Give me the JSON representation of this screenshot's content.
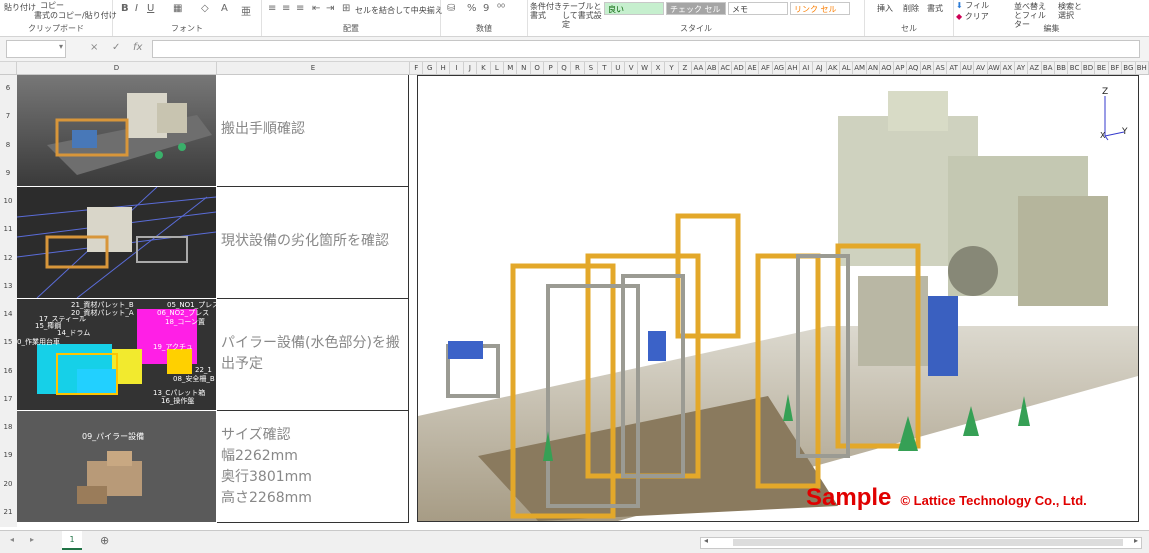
{
  "ribbon": {
    "clipboard": {
      "paste_label": "貼り付け",
      "copy_label": "コピー",
      "format_painter_label": "書式のコピー/貼り付け",
      "group_label": "クリップボード"
    },
    "font_group_label": "フォント",
    "alignment": {
      "merge_label": "セルを結合して中央揃え",
      "group_label": "配置"
    },
    "number": {
      "group_label": "数値",
      "percent_symbol": "%",
      "comma_symbol": "9"
    },
    "styles": {
      "conditional_format_label": "条件付き書式",
      "table_format_label": "テーブルとして書式設定",
      "cells": [
        {
          "label": "良い",
          "bg": "#c6efce",
          "fg": "#006100"
        },
        {
          "label": "チェック セル",
          "bg": "#a5a5a5",
          "fg": "#ffffff"
        },
        {
          "label": "メモ",
          "bg": "#ffffff",
          "fg": "#333333"
        },
        {
          "label": "リンク セル",
          "bg": "#ffffff",
          "fg": "#fa7d00"
        }
      ],
      "group_label": "スタイル"
    },
    "cells_group": {
      "insert_label": "挿入",
      "delete_label": "削除",
      "format_label": "書式",
      "group_label": "セル"
    },
    "editing": {
      "fill_label": "フィル",
      "clear_label": "クリア",
      "sort_label": "並べ替えとフィルター",
      "find_label": "検索と選択",
      "group_label": "編集"
    }
  },
  "formula_bar": {
    "fx_label": "fx",
    "cancel_symbol": "×",
    "confirm_symbol": "✓"
  },
  "columns": {
    "wide": [
      {
        "label": "D"
      },
      {
        "label": "E"
      }
    ],
    "narrow": [
      "F",
      "G",
      "H",
      "I",
      "J",
      "K",
      "L",
      "M",
      "N",
      "O",
      "P",
      "Q",
      "R",
      "S",
      "T",
      "U",
      "V",
      "W",
      "X",
      "Y",
      "Z",
      "AA",
      "AB",
      "AC",
      "AD",
      "AE",
      "AF",
      "AG",
      "AH",
      "AI",
      "AJ",
      "AK",
      "AL",
      "AM",
      "AN",
      "AO",
      "AP",
      "AQ",
      "AR",
      "AS",
      "AT",
      "AU",
      "AV",
      "AW",
      "AX",
      "AY",
      "AZ",
      "BA",
      "BB",
      "BC",
      "BD",
      "BE",
      "BF",
      "BG",
      "BH"
    ]
  },
  "rows": [
    "6",
    "7",
    "8",
    "9",
    "10",
    "11",
    "12",
    "13",
    "14",
    "15",
    "16",
    "17",
    "18",
    "19",
    "20",
    "21"
  ],
  "cells": [
    {
      "lines": [
        "搬出手順確認"
      ]
    },
    {
      "lines": [
        "現状設備の劣化箇所を確認"
      ]
    },
    {
      "lines": [
        "パイラー設備(水色部分)を搬",
        "出予定"
      ]
    },
    {
      "lines": [
        "サイズ確認",
        "幅2262mm",
        "奥行3801mm",
        "高さ2268mm"
      ]
    }
  ],
  "thumb3_labels": [
    "21_資材パレット_B",
    "05_NO1_プレス",
    "20_資材パレット_A",
    "06_NO2_プレス",
    "17_スティール",
    "18_コーン置",
    "15_棒鋼",
    "14_ドラム",
    "0_作業用台車",
    "19_アクチュ",
    "22_1",
    "08_安全柵_B",
    "13_Cパレット箱",
    "16_操作盤"
  ],
  "thumb4_label": "09_パイラー設備",
  "panel": {
    "axis_z": "Z",
    "axis_x": "X",
    "axis_y": "Y",
    "watermark_sample": "Sample",
    "watermark_copy": "© Lattice Technology Co., Ltd.",
    "watermark_color": "#e00000"
  },
  "sheet_tabs": [
    {
      "label": "1"
    }
  ],
  "add_sheet": "⊕"
}
